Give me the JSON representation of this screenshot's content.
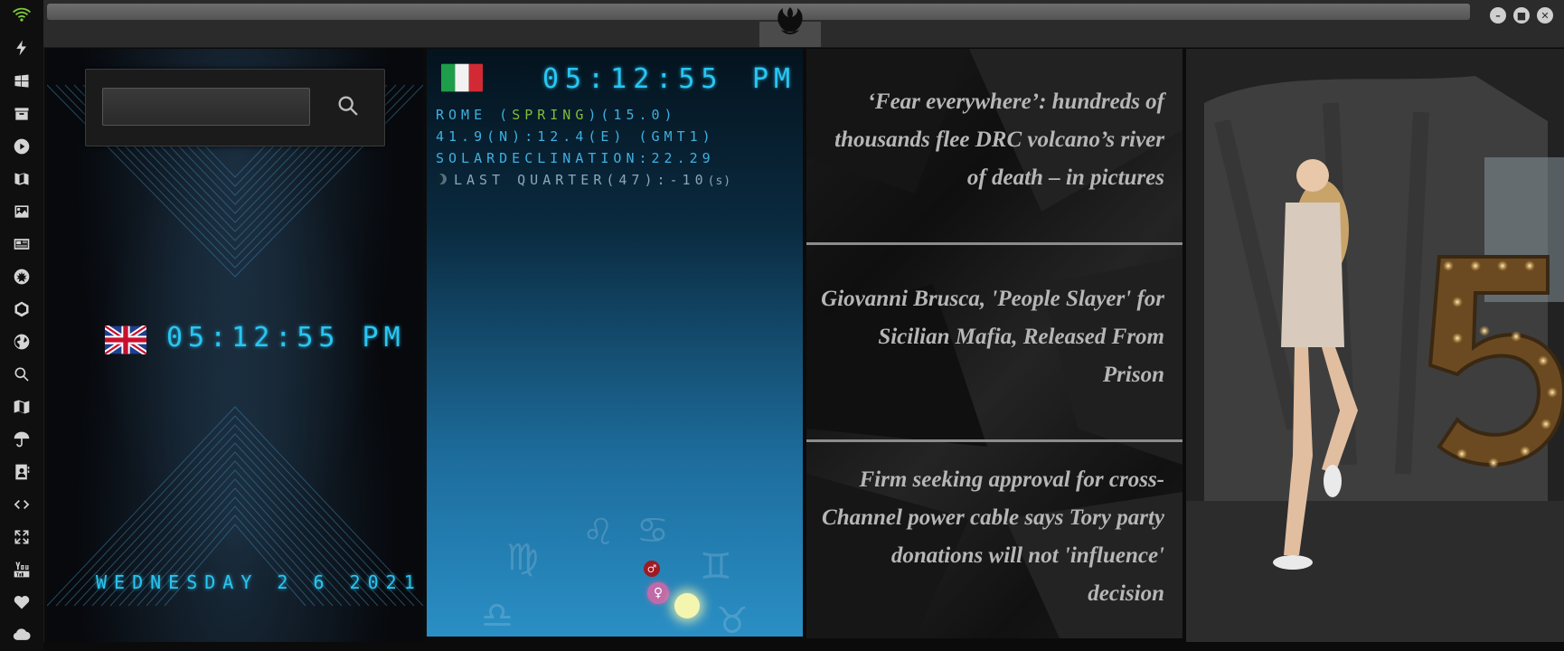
{
  "rail": {
    "icons": [
      "wifi-icon",
      "bolt-icon",
      "windows-icon",
      "archive-icon",
      "play-icon",
      "map-book-icon",
      "image-icon",
      "news-icon",
      "rebel-icon",
      "empire-icon",
      "globe-icon",
      "search-icon",
      "map-icon",
      "umbrella-icon",
      "contacts-icon",
      "code-icon",
      "expand-icon",
      "youtube-icon",
      "heart-icon",
      "cloud-icon"
    ],
    "accent": "#7ec83a"
  },
  "clock_uk": {
    "time": "05:12:55 PM",
    "date": "WEDNESDAY 2 6 2021"
  },
  "search": {
    "placeholder": ""
  },
  "clock_it": {
    "time": "05:12:55",
    "ampm": "PM",
    "location_prefix": "ROME (",
    "season": "SPRING",
    "location_suffix": ")(15.0)",
    "coords": "41.9(N):12.4(E) (GMT1)",
    "solar": "SOLARDECLINATION:22.29",
    "moon": "LAST QUARTER(47):-10",
    "moon_unit": "(s)"
  },
  "news": {
    "items": [
      "‘Fear everywhere’: hundreds of thousands flee DRC volcano’s river of death – in pictures",
      "Giovanni Brusca, 'People Slayer' for Sicilian Mafia, Released From Prison",
      "Firm seeking approval for cross-Channel power cable says Tory party donations will not 'influence' decision"
    ]
  },
  "colors": {
    "led": "#29c6f2",
    "season": "#7ebd3a",
    "news_text": "#b6b6b6"
  }
}
